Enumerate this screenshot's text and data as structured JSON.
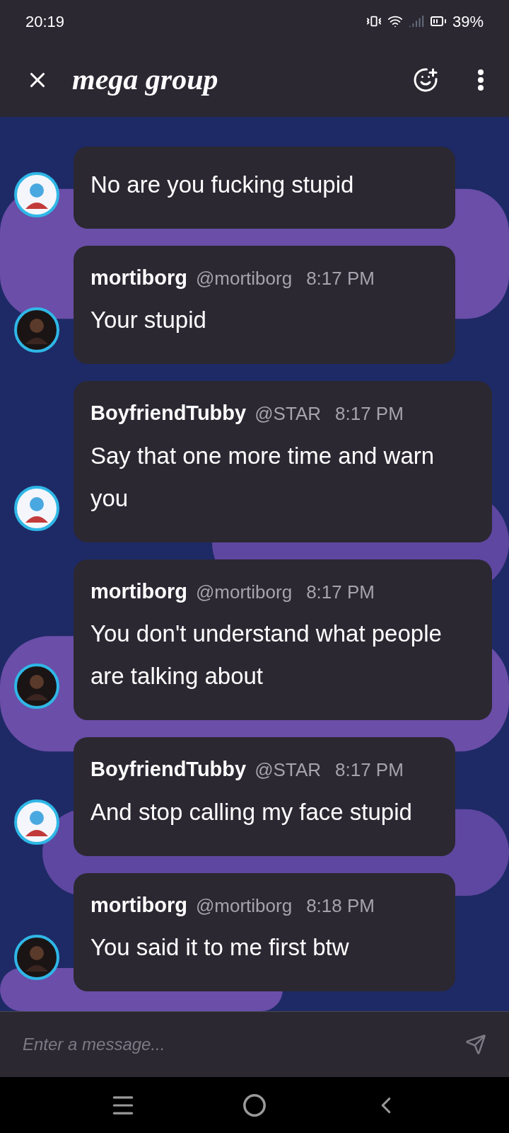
{
  "status_bar": {
    "time": "20:19",
    "battery": "39%"
  },
  "header": {
    "title": "mega group"
  },
  "messages": [
    {
      "kind": "light",
      "text": "No are you fucking stupid"
    },
    {
      "kind": "dark",
      "author": "mortiborg",
      "handle": "@mortiborg",
      "time": "8:17 PM",
      "text": "Your stupid"
    },
    {
      "kind": "light",
      "author": "BoyfriendTubby",
      "handle": "@STAR",
      "time": "8:17 PM",
      "text": "Say that one more time and warn you"
    },
    {
      "kind": "dark",
      "author": "mortiborg",
      "handle": "@mortiborg",
      "time": "8:17 PM",
      "text": "You don't understand what people are talking about"
    },
    {
      "kind": "light",
      "author": "BoyfriendTubby",
      "handle": "@STAR",
      "time": "8:17 PM",
      "text": "And stop calling my face stupid"
    },
    {
      "kind": "dark",
      "author": "mortiborg",
      "handle": "@mortiborg",
      "time": "8:18 PM",
      "text": "You said it to me first btw"
    }
  ],
  "composer": {
    "placeholder": "Enter a message..."
  }
}
